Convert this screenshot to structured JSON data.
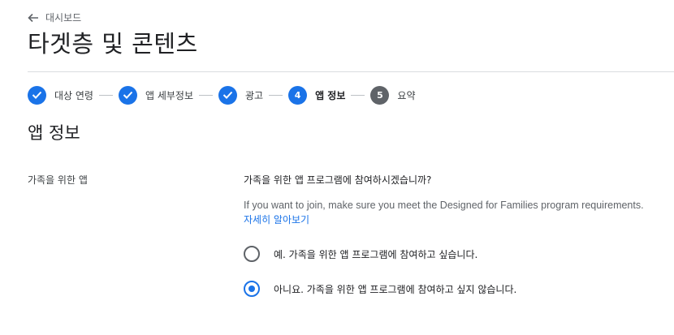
{
  "breadcrumb": {
    "back_label": "대시보드"
  },
  "page": {
    "title": "타겟층 및 콘텐츠"
  },
  "stepper": {
    "steps": [
      {
        "label": "대상 연령",
        "status": "done"
      },
      {
        "label": "앱 세부정보",
        "status": "done"
      },
      {
        "label": "광고",
        "status": "done"
      },
      {
        "label": "앱 정보",
        "status": "active",
        "number": "4"
      },
      {
        "label": "요약",
        "status": "pending",
        "number": "5"
      }
    ]
  },
  "section": {
    "title": "앱 정보",
    "field_label": "가족을 위한 앱",
    "question": "가족을 위한 앱 프로그램에 참여하시겠습니까?",
    "help_text": "If you want to join, make sure you meet the Designed for Families program requirements.",
    "learn_more": "자세히 알아보기",
    "options": [
      {
        "label": "예. 가족을 위한 앱 프로그램에 참여하고 싶습니다.",
        "selected": false
      },
      {
        "label": "아니요. 가족을 위한 앱 프로그램에 참여하고 싶지 않습니다.",
        "selected": true
      }
    ]
  },
  "colors": {
    "accent": "#1a73e8",
    "step_pending": "#5f6368",
    "divider": "#dadce0"
  }
}
